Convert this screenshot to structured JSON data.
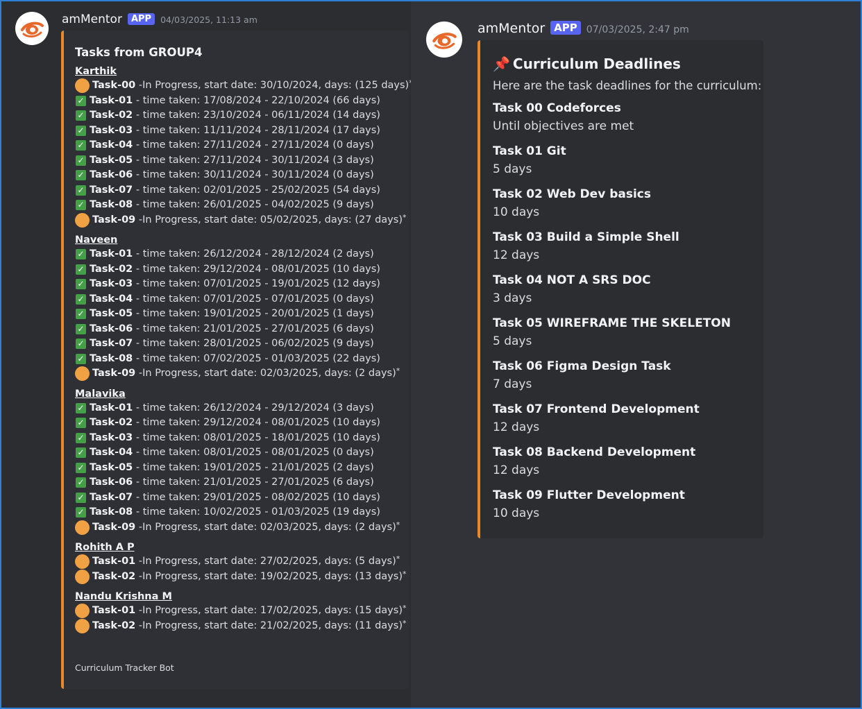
{
  "colors": {
    "accent": "#e8882b",
    "app_badge": "#5865f2",
    "done": "#43a047",
    "in_progress": "#f0a143"
  },
  "left_message": {
    "username": "amMentor",
    "badge": "APP",
    "timestamp": "04/03/2025, 11:13 am",
    "avatar_icon": "ammentor-logo-icon",
    "embed": {
      "title": "Tasks from GROUP4",
      "members": [
        {
          "name": "Karthik",
          "tasks": [
            {
              "status": "in-progress",
              "task": "Task-00",
              "detail": " -In Progress, start date: 30/10/2024, days: (125 days)"
            },
            {
              "status": "done",
              "task": "Task-01",
              "detail": " - time taken: 17/08/2024 - 22/10/2024 (66 days)"
            },
            {
              "status": "done",
              "task": "Task-02",
              "detail": " - time taken: 23/10/2024 - 06/11/2024 (14 days)"
            },
            {
              "status": "done",
              "task": "Task-03",
              "detail": " - time taken: 11/11/2024 - 28/11/2024 (17 days)"
            },
            {
              "status": "done",
              "task": "Task-04",
              "detail": " - time taken: 27/11/2024 - 27/11/2024 (0 days)"
            },
            {
              "status": "done",
              "task": "Task-05",
              "detail": " - time taken: 27/11/2024 - 30/11/2024 (3 days)"
            },
            {
              "status": "done",
              "task": "Task-06",
              "detail": " - time taken: 30/11/2024 - 30/11/2024 (0 days)"
            },
            {
              "status": "done",
              "task": "Task-07",
              "detail": " - time taken: 02/01/2025 - 25/02/2025 (54 days)"
            },
            {
              "status": "done",
              "task": "Task-08",
              "detail": " - time taken: 26/01/2025 - 04/02/2025 (9 days)"
            },
            {
              "status": "in-progress",
              "task": "Task-09",
              "detail": " -In Progress, start date: 05/02/2025, days: (27 days)"
            }
          ]
        },
        {
          "name": "Naveen",
          "tasks": [
            {
              "status": "done",
              "task": "Task-01",
              "detail": " - time taken: 26/12/2024 - 28/12/2024 (2 days)"
            },
            {
              "status": "done",
              "task": "Task-02",
              "detail": " - time taken: 29/12/2024 - 08/01/2025 (10 days)"
            },
            {
              "status": "done",
              "task": "Task-03",
              "detail": " - time taken: 07/01/2025 - 19/01/2025 (12 days)"
            },
            {
              "status": "done",
              "task": "Task-04",
              "detail": " - time taken: 07/01/2025 - 07/01/2025 (0 days)"
            },
            {
              "status": "done",
              "task": "Task-05",
              "detail": " - time taken: 19/01/2025 - 20/01/2025 (1 days)"
            },
            {
              "status": "done",
              "task": "Task-06",
              "detail": " - time taken: 21/01/2025 - 27/01/2025 (6 days)"
            },
            {
              "status": "done",
              "task": "Task-07",
              "detail": " - time taken: 28/01/2025 - 06/02/2025 (9 days)"
            },
            {
              "status": "done",
              "task": "Task-08",
              "detail": " - time taken: 07/02/2025 - 01/03/2025 (22 days)"
            },
            {
              "status": "in-progress",
              "task": "Task-09",
              "detail": " -In Progress, start date: 02/03/2025, days: (2 days)"
            }
          ]
        },
        {
          "name": "Malavika",
          "tasks": [
            {
              "status": "done",
              "task": "Task-01",
              "detail": " - time taken: 26/12/2024 - 29/12/2024 (3 days)"
            },
            {
              "status": "done",
              "task": "Task-02",
              "detail": " - time taken: 29/12/2024 - 08/01/2025 (10 days)"
            },
            {
              "status": "done",
              "task": "Task-03",
              "detail": " - time taken: 08/01/2025 - 18/01/2025 (10 days)"
            },
            {
              "status": "done",
              "task": "Task-04",
              "detail": " - time taken: 08/01/2025 - 08/01/2025 (0 days)"
            },
            {
              "status": "done",
              "task": "Task-05",
              "detail": " - time taken: 19/01/2025 - 21/01/2025 (2 days)"
            },
            {
              "status": "done",
              "task": "Task-06",
              "detail": " - time taken: 21/01/2025 - 27/01/2025 (6 days)"
            },
            {
              "status": "done",
              "task": "Task-07",
              "detail": " - time taken: 29/01/2025 - 08/02/2025 (10 days)"
            },
            {
              "status": "done",
              "task": "Task-08",
              "detail": " - time taken: 10/02/2025 - 01/03/2025 (19 days)"
            },
            {
              "status": "in-progress",
              "task": "Task-09",
              "detail": " -In Progress, start date: 02/03/2025, days: (2 days)"
            }
          ]
        },
        {
          "name": "Rohith A P",
          "tasks": [
            {
              "status": "in-progress",
              "task": "Task-01",
              "detail": " -In Progress, start date: 27/02/2025, days: (5 days)"
            },
            {
              "status": "in-progress",
              "task": "Task-02",
              "detail": " -In Progress, start date: 19/02/2025, days: (13 days)"
            }
          ]
        },
        {
          "name": "Nandu Krishna M",
          "tasks": [
            {
              "status": "in-progress",
              "task": "Task-01",
              "detail": " -In Progress, start date: 17/02/2025, days: (15 days)"
            },
            {
              "status": "in-progress",
              "task": "Task-02",
              "detail": " -In Progress, start date: 21/02/2025, days: (11 days)"
            }
          ]
        }
      ],
      "footer": "Curriculum Tracker Bot"
    }
  },
  "right_message": {
    "username": "amMentor",
    "badge": "APP",
    "timestamp": "07/03/2025, 2:47 pm",
    "avatar_icon": "ammentor-logo-icon",
    "embed": {
      "title_icon": "pushpin-icon",
      "title": "Curriculum Deadlines",
      "description": "Here are the task deadlines for the curriculum:",
      "items": [
        {
          "name": "Task 00 Codeforces",
          "duration": "Until objectives are met"
        },
        {
          "name": "Task 01 Git",
          "duration": "5 days"
        },
        {
          "name": "Task 02 Web Dev basics",
          "duration": "10 days"
        },
        {
          "name": "Task 03 Build a Simple Shell",
          "duration": "12 days"
        },
        {
          "name": "Task 04 NOT A SRS DOC",
          "duration": "3 days"
        },
        {
          "name": "Task 05 WIREFRAME THE SKELETON",
          "duration": "5 days"
        },
        {
          "name": "Task 06 Figma Design Task",
          "duration": "7 days"
        },
        {
          "name": "Task 07 Frontend Development",
          "duration": "12 days"
        },
        {
          "name": "Task 08 Backend Development",
          "duration": "12 days"
        },
        {
          "name": "Task 09 Flutter Development",
          "duration": "10 days"
        }
      ]
    }
  }
}
